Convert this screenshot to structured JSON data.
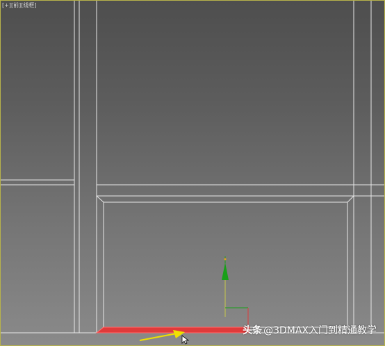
{
  "viewport": {
    "label_parts": [
      "[+]",
      "[前]",
      "[线框]"
    ],
    "border_color": "#b8b34a",
    "wire_color": "#e8e8e8",
    "selection_color": "#e03a3a"
  },
  "gizmo": {
    "y_axis_color": "#18a018",
    "x_axis_color": "#e03a3a",
    "plane_color": "#c8c84a"
  },
  "annotation": {
    "arrow_color": "#f0e000"
  },
  "cursor": {
    "icon": "mouse-pointer-icon"
  },
  "watermark": {
    "brand": "头条",
    "handle": "@3DMAX入门到精通教学"
  }
}
